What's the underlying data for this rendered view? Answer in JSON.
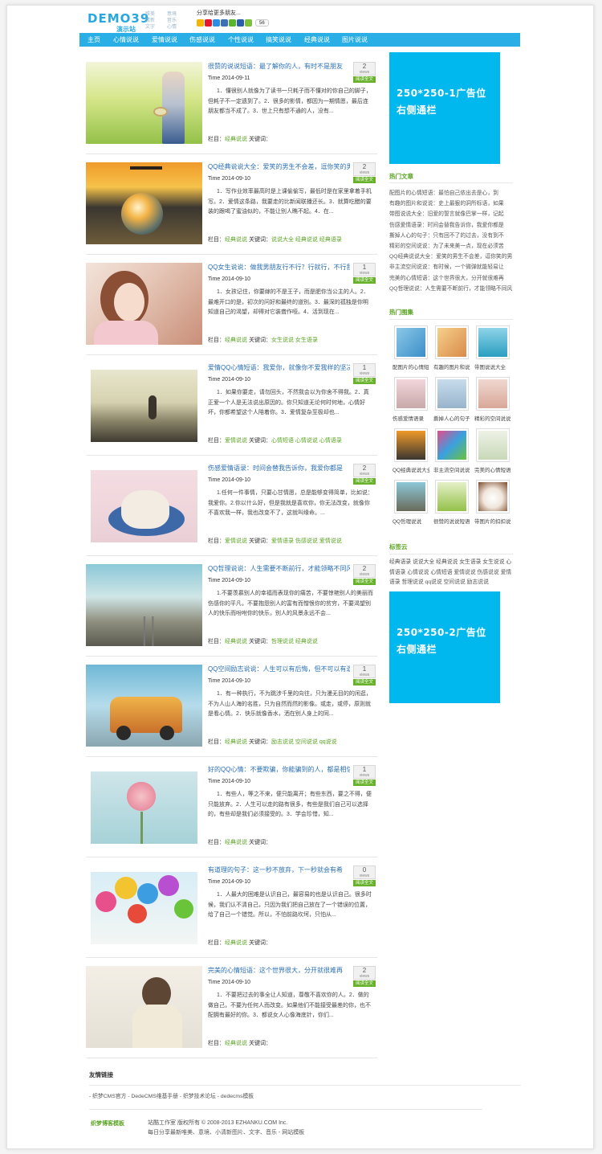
{
  "header": {
    "logo": "DEMO39",
    "logo_sub": "演示站",
    "logo_tags": [
      "唯美",
      "意境",
      "清新",
      "音乐",
      "文字",
      "心情"
    ],
    "share_title": "分享给更多朋友...",
    "share_count": "56"
  },
  "nav": [
    "主页",
    "心情说说",
    "爱情说说",
    "伤感说说",
    "个性说说",
    "搞笑说说",
    "经典说说",
    "图片说说"
  ],
  "posts": [
    {
      "title": "很赞的说说短语：最了解你的人，有时不是朋友",
      "time": "Time 2014-09-11",
      "excerpt": "1．懂很别人就像为了读书一只耗子而不懂对的你自己的脚子，但耗子不一定遗到了。2．很多的影情，都因为一期情愿，最后连朋友都当不成了。3．世上只有想不通的人，没有...",
      "views": "2",
      "category": "经典说说",
      "keywords": ""
    },
    {
      "title": "QQ经典说说大全：爱笑的男生不会差，逗你笑的男",
      "time": "Time 2014-09-10",
      "excerpt": "1．写作业效率最高时是上课偷偷写，最低时是在家里拿着手机写。2．爱情这条路，我要走的比新闻联播还长。3．就算吃醋的要装的跟喝了蜜油似的，不能让别人瞧不起。4．在...",
      "views": "2",
      "category": "经典说说",
      "keywords": "说说大全 经典说说 经典语录"
    },
    {
      "title": "QQ女生说说：做我男朋友行不行？行就行，不行我",
      "time": "Time 2014-09-10",
      "excerpt": "1．女孩记住，你要嫁的不是王子，而是肥你当公主的人。2．最难开口的是，初次的问好和最终的道别。3．最深的孤独是你明知道自己的渴望，却得对它装聋作哑。4．活到现在...",
      "views": "1",
      "category": "经典说说",
      "keywords": "女生说说 女生语录"
    },
    {
      "title": "爱情QQ心情短语：我爱你，就像你不爱我样的坚决",
      "time": "Time 2014-09-10",
      "excerpt": "1．如果你要走，请勿回头，不然我会以为你舍不得我。2．真正爱一个人是无法说出原因的。你只知道无论何时何地，心情好坏，你都希望这个人陪着你。3．爱情复杂至极却也...",
      "views": "1",
      "category": "爱情说说",
      "keywords": "心情短语 心情说说 心情语录"
    },
    {
      "title": "伤感爱情语录：时间会替我告诉你，我爱你都是",
      "time": "Time 2014-09-10",
      "excerpt": "1.任何一件事情，只要心甘情愿，总是能够变得简单，比如说：我爱你。2.你以什么好，但是我就是喜欢你，你无法改变，就像你不喜欢我一样，我也改变不了，这就叫缘命。...",
      "views": "2",
      "category": "爱情说说",
      "keywords": "爱情语录 伤感说说 爱情说说"
    },
    {
      "title": "QQ哲理说说：人生需要不断前行，才能领略不同风",
      "time": "Time 2014-09-10",
      "excerpt": "1.不要羡慕别人的幸福而表现你的痛苦，不要惊艳别人的美丽而伤感你的平凡，不要抱怨别人的富有而憎恨你的贫穷，不要渴望别人的快乐而吩咐你的快乐，别人的风景永远不会...",
      "views": "2",
      "category": "经典说说",
      "keywords": "哲理说说 经典说说"
    },
    {
      "title": "QQ空间励志说说：人生可以有后悔，但不可以有遗",
      "time": "Time 2014-09-10",
      "excerpt": "1．有一种执行，不为跳涉千里的向往，只为漫无目的的闲逛，不为人山人海的名胜，只为自然而然的影像。或走，或停，原则就是看心情。2．快乐就像香水，洒在别人身上的同...",
      "views": "1",
      "category": "经典说说",
      "keywords": "励志说说 空间说说 qq说说"
    },
    {
      "title": "好的QQ心情：不要欺骗，你能骗到的人，都是相信",
      "time": "Time 2014-09-10",
      "excerpt": "1．有些人，等之不来，便只能离开；有些东西，要之不得，便只能放弃。2．人生可以走的路有很多，有些是我们自己可以选择的，有些却是我们必须接受的。3．学会珍惜，知...",
      "views": "1",
      "category": "经典说说",
      "keywords": ""
    },
    {
      "title": "有道理的句子：这一秒不放弃，下一秒就会有希",
      "time": "Time 2014-09-10",
      "excerpt": "1．人最大的困难是认识自己，最容易的也是认识自己。很多时候，我们认不清自己，只因为我们把自己放在了一个错误的位置，给了自己一个错觉。所以，不怕前路坎坷，只怕从...",
      "views": "0",
      "category": "经典说说",
      "keywords": ""
    },
    {
      "title": "完美的心情短语：这个世界很大，分开就很难再",
      "time": "Time 2014-09-10",
      "excerpt": "1．不要把过去的事全让人知道，尊敬不喜欢你的人。2．做的做自己，不要为任何人而改变。如果他们不能接受最差的你，也不配拥有最好的你。3．都说女人心像海底针，你们...",
      "views": "2",
      "category": "经典说说",
      "keywords": ""
    }
  ],
  "labels": {
    "category": "栏目：",
    "keywords": "关键词：",
    "views": "views",
    "readmore": "阅读全文"
  },
  "sidebar": {
    "ad1": [
      "250*250-1广告位",
      "右侧通栏"
    ],
    "ad2": [
      "250*250-2广告位",
      "右侧通栏"
    ],
    "hot_articles_title": "热门文章",
    "hot_articles": [
      "配图片的心情短语：最怕自己依出去是心，到",
      "有趣的图片和说说：史上最狠的洞所标语，如果",
      "带图说说大全：旧爱的誓言就像巴掌一样，记起",
      "伤感爱情语录：时间会替我告诉你，我爱你都是",
      "撕掉人心的句子：只有回不了的过去，没有到不",
      "精彩的空间说说：为了未来美一点，现在必须苦",
      "QQ经典说说大全：爱笑的男生不会差，逗你笑的男",
      "非主流空间说说：有时候，一个微弹就能轻易让",
      "完美的心情短语：这个世界很大，分开就很难再",
      "QQ哲理说说：人生需要不断前行，才能领略不同风"
    ],
    "hot_pics_title": "热门图集",
    "hot_pics": [
      "配图片的心情短语",
      "有趣的图片和说说",
      "带图说说大全",
      "伤感爱情语录",
      "撕掉人心的句子",
      "精彩的空间说说",
      "QQ经典说说大全",
      "非主流空间说说",
      "完美的心情短语",
      "QQ哲理说说",
      "很赞的说说短语",
      "带图片的扣扣说说"
    ],
    "tags_title": "标签云",
    "tags": "经典语录 说说大全 经典说说 女生语录 女生说说 心情语录 心情说说 心情短语 爱情说说 伤感说说 爱情语录 哲理说说 qq说说 空间说说 励志说说"
  },
  "friend_links_title": "友情链接",
  "friend_links": "- 织梦CMS官方 - DedeCMS维基手册 - 织梦技术论坛 - dedecms模板",
  "footer": {
    "brand": "织梦博客模板",
    "copyright": "站酷工作室 版权所有 © 2008-2013 EZHANKU.COM Inc.",
    "slogan": "每日分享最新唯美、意境、小清新图片、文字、音乐 - 网站模板"
  }
}
